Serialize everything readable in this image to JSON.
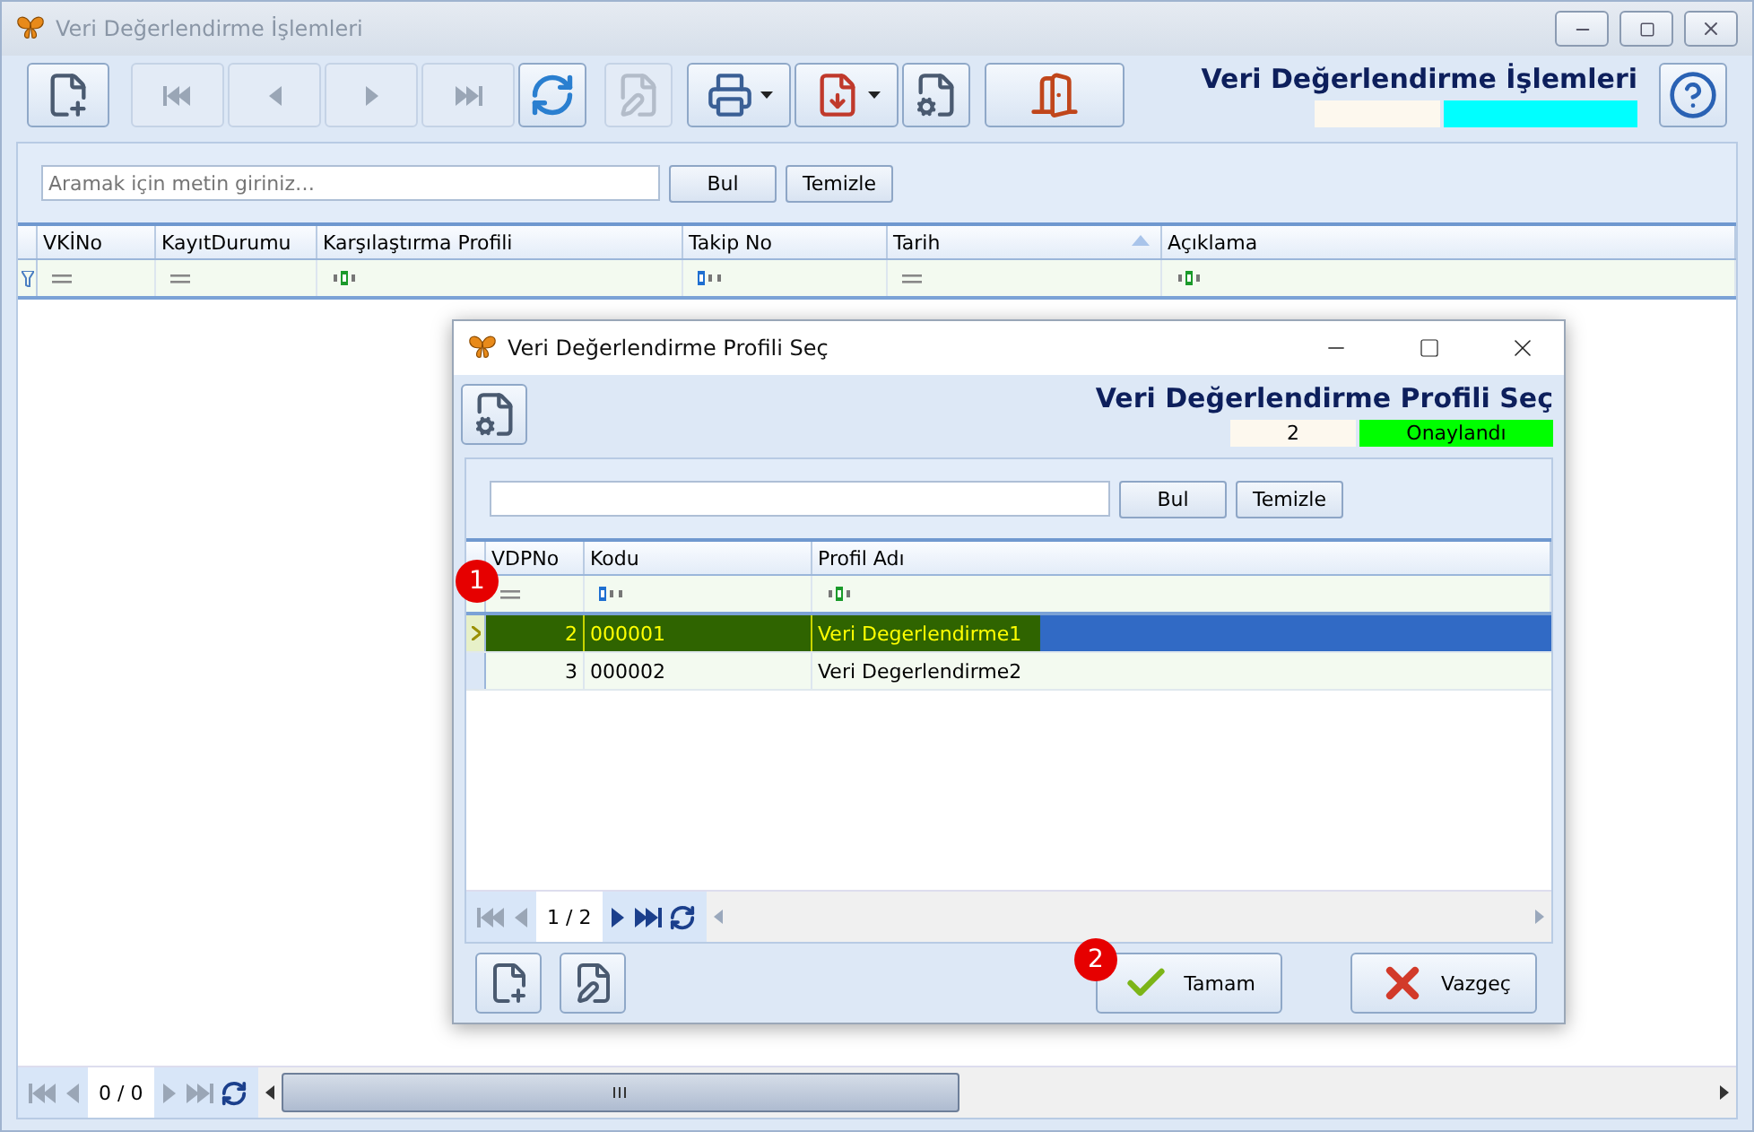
{
  "window": {
    "title": "Veri Değerlendirme İşlemleri"
  },
  "toolbar": [
    {
      "kind": "new",
      "disabled": false
    },
    {
      "kind": "first",
      "disabled": true
    },
    {
      "kind": "prev",
      "disabled": true
    },
    {
      "kind": "next",
      "disabled": true
    },
    {
      "kind": "last",
      "disabled": true
    },
    {
      "kind": "refresh",
      "disabled": false
    },
    {
      "kind": "edit",
      "disabled": true
    },
    {
      "kind": "print",
      "disabled": false,
      "dropdown": true
    },
    {
      "kind": "pdf",
      "disabled": false,
      "dropdown": true
    },
    {
      "kind": "settings",
      "disabled": false
    },
    {
      "kind": "exit",
      "disabled": false
    }
  ],
  "header": {
    "title": "Veri Değerlendirme İşlemleri"
  },
  "search": {
    "placeholder": "Aramak için metin giriniz…",
    "buttons": [
      "Bul",
      "Temizle"
    ]
  },
  "grid": {
    "columns": [
      {
        "label": "VKİNo",
        "kind": "equals",
        "sorted": false
      },
      {
        "label": "KayıtDurumu",
        "kind": "equals",
        "sorted": false
      },
      {
        "label": "Karşılaştırma Profili",
        "kind": "contains",
        "sorted": false
      },
      {
        "label": "Takip No",
        "kind": "begins",
        "sorted": false
      },
      {
        "label": "Tarih",
        "kind": "equals",
        "sorted": true
      },
      {
        "label": "Açıklama",
        "kind": "contains",
        "sorted": false
      }
    ]
  },
  "pager": {
    "text": "0 / 0"
  },
  "dialog": {
    "title": "Veri Değerlendirme Profili Seç",
    "heading": "Veri Değerlendirme Profili Seç",
    "count": "2",
    "status": "Onaylandı",
    "search": {
      "buttons": [
        "Bul",
        "Temizle"
      ]
    },
    "grid": {
      "marker": "1",
      "columns": [
        {
          "label": "VDPNo",
          "kind": "equals"
        },
        {
          "label": "Kodu",
          "kind": "begins"
        },
        {
          "label": "Profil Adı",
          "kind": "contains"
        }
      ],
      "rows": [
        {
          "cells": [
            "2",
            "000001",
            "Veri Degerlendirme1"
          ],
          "selected": true
        },
        {
          "cells": [
            "3",
            "000002",
            "Veri Degerlendirme2"
          ],
          "selected": false
        }
      ]
    },
    "pager": {
      "text": "1 / 2"
    },
    "buttons": [
      {
        "kind": "ok",
        "label": "Tamam",
        "marker": "2"
      },
      {
        "kind": "cancel",
        "label": "Vazgeç"
      }
    ]
  }
}
